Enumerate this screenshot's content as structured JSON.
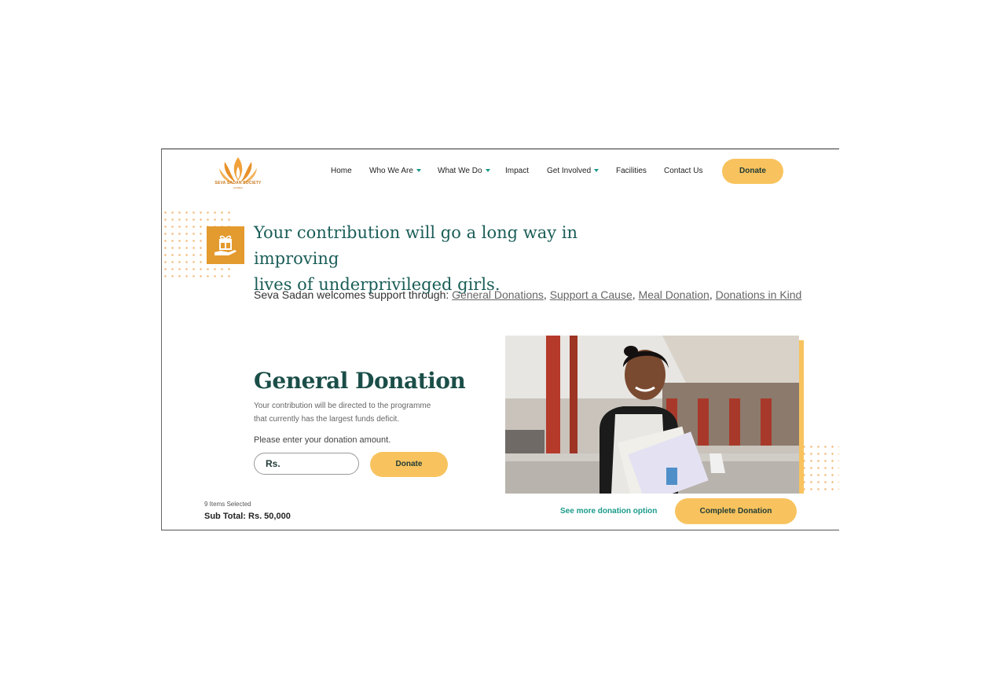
{
  "logo": {
    "name": "SEVA SADAN SOCIETY",
    "sub": "MUMBAI"
  },
  "nav": {
    "items": [
      "Home",
      "Who We Are",
      "What We Do",
      "Impact",
      "Get Involved",
      "Facilities",
      "Contact Us"
    ],
    "donate_label": "Donate"
  },
  "hero": {
    "headline_line1": "Your contribution will go a long way in improving",
    "headline_line2": "lives of underprivileged girls.",
    "support_prefix": "Seva Sadan welcomes support through:",
    "support_links": [
      "General Donations",
      "Support a Cause",
      "Meal Donation",
      "Donations in Kind"
    ],
    "icon": "gift-hand-icon"
  },
  "general_donation": {
    "title": "General Donation",
    "desc_line1": "Your contribution will be directed to the programme",
    "desc_line2": "that currently has the largest funds deficit.",
    "prompt": "Please enter your donation amount.",
    "input_placeholder": "Rs.",
    "donate_label": "Donate"
  },
  "footer_bar": {
    "items_selected": "9 Items Selected",
    "subtotal": "Sub Total: Rs. 50,000",
    "see_more": "See more donation option",
    "complete_label": "Complete Donation"
  },
  "colors": {
    "accent": "#f8c35e",
    "teal": "#1b5e58",
    "orange": "#e39a2e"
  }
}
